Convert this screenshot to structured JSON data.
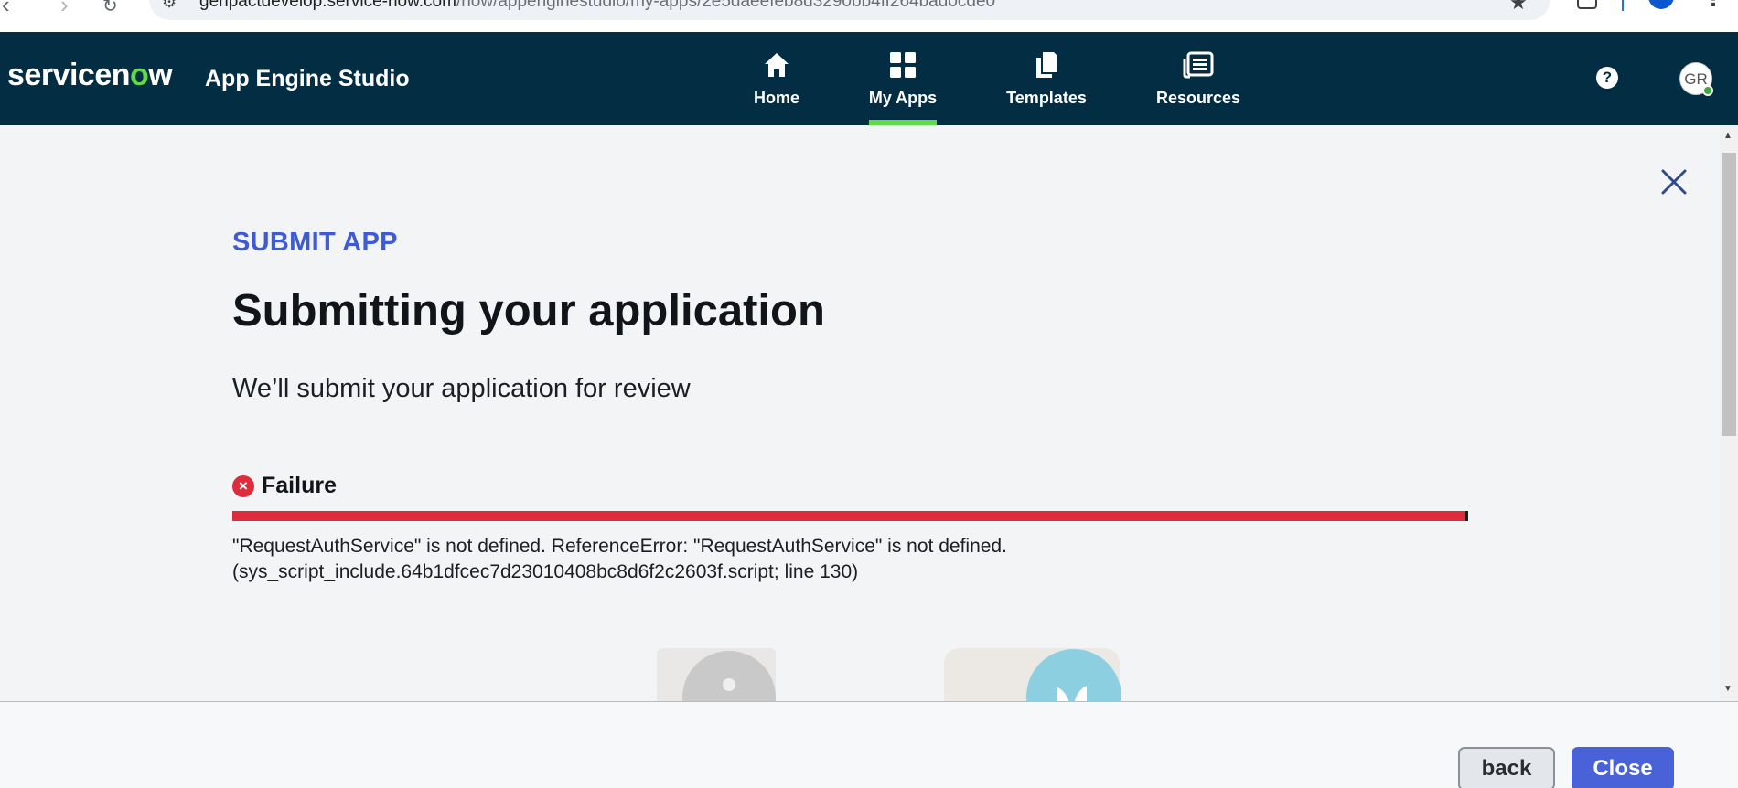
{
  "browser": {
    "url_host": "genpactdevelop.service-now.com",
    "url_path": "/now/appenginestudio/my-apps/2e5daeefeb8d3290bb4ff264bad0cde0"
  },
  "header": {
    "logo_pre": "servicen",
    "logo_o": "o",
    "logo_post": "w",
    "app_title": "App Engine Studio",
    "nav": [
      {
        "label": "Home",
        "icon": "home-icon",
        "active": false
      },
      {
        "label": "My Apps",
        "icon": "grid-icon",
        "active": true
      },
      {
        "label": "Templates",
        "icon": "templates-icon",
        "active": false
      },
      {
        "label": "Resources",
        "icon": "resources-icon",
        "active": false
      }
    ],
    "help_glyph": "?",
    "avatar_initials": "GR",
    "accent_color": "#62d84e",
    "header_color": "#032d42"
  },
  "modal": {
    "eyebrow": "SUBMIT APP",
    "title": "Submitting your application",
    "subtitle": "We’ll submit your application for review",
    "status": {
      "label": "Failure",
      "icon": "error-circle-icon",
      "color": "#de2c3c",
      "progress": 1.0
    },
    "error_message": "\"RequestAuthService\" is not defined. ReferenceError: \"RequestAuthService\" is not defined. (sys_script_include.64b1dfcec7d23010408bc8d6f2c2603f.script; line 130)"
  },
  "footer": {
    "back_label": "back",
    "close_label": "Close",
    "primary_color": "#4a62d8"
  }
}
